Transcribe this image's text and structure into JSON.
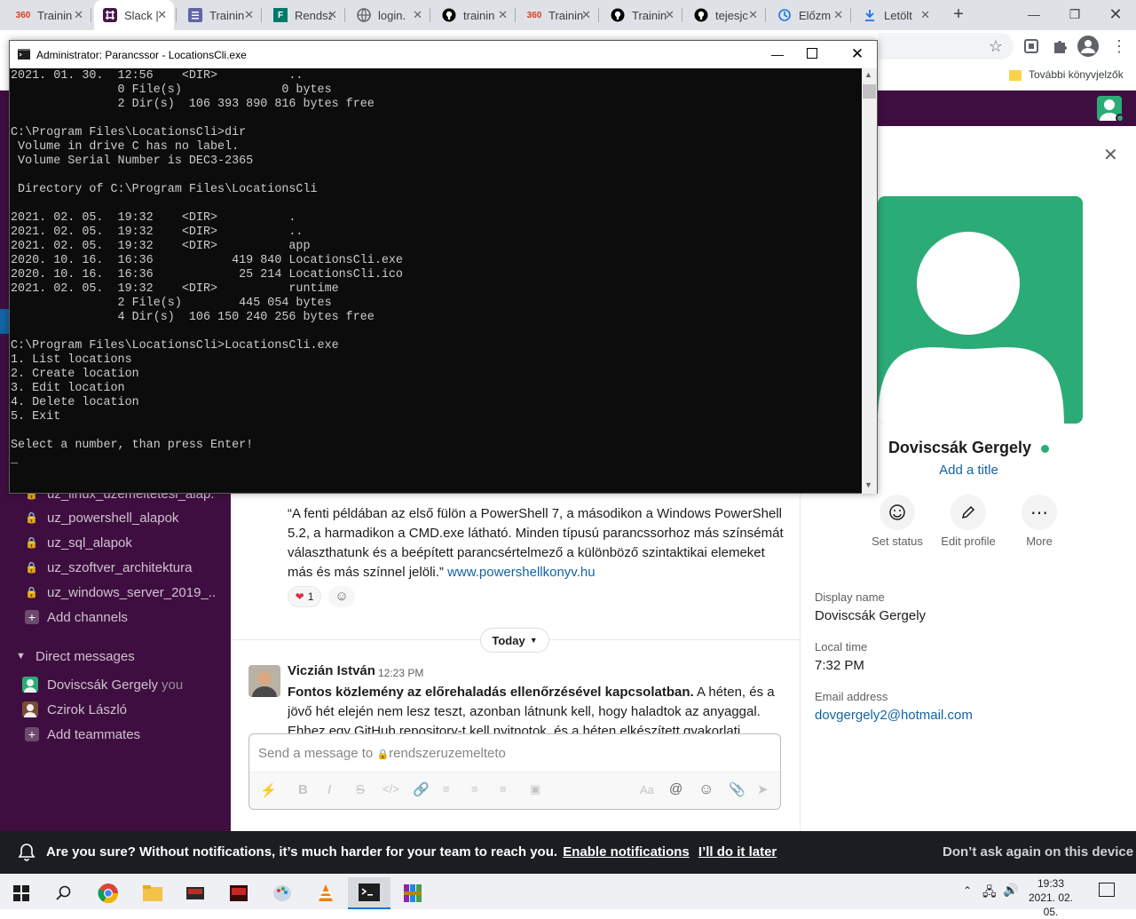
{
  "browser": {
    "tabs": [
      {
        "favicon": "360",
        "title": "Trainin",
        "fav_color": "#e03b25",
        "active": false
      },
      {
        "favicon": "slack-icon",
        "title": "Slack |",
        "fav_color": "#4a154b",
        "active": true
      },
      {
        "favicon": "forms-icon",
        "title": "Trainin",
        "fav_color": "#6264a7",
        "active": false
      },
      {
        "favicon": "F",
        "title": "Rendsz",
        "fav_color": "#00796b",
        "active": false
      },
      {
        "favicon": "globe-icon",
        "title": "login.",
        "fav_color": "#5f6368",
        "active": false
      },
      {
        "favicon": "github-icon",
        "title": "trainin",
        "fav_color": "#000000",
        "active": false
      },
      {
        "favicon": "360",
        "title": "Trainin",
        "fav_color": "#e03b25",
        "active": false
      },
      {
        "favicon": "github-icon",
        "title": "Trainin",
        "fav_color": "#000000",
        "active": false
      },
      {
        "favicon": "github-icon",
        "title": "tejesjc",
        "fav_color": "#000000",
        "active": false
      },
      {
        "favicon": "history-icon",
        "title": "Előzm",
        "fav_color": "#1a73e8",
        "active": false
      },
      {
        "favicon": "download-icon",
        "title": "Letölt",
        "fav_color": "#1a73e8",
        "active": false
      }
    ],
    "bookmarks_other": "További könyvjelzők"
  },
  "cmd": {
    "title": "Administrator: Parancssor - LocationsCli.exe",
    "lines": [
      "2021. 01. 30.  12:56    <DIR>          ..",
      "               0 File(s)              0 bytes",
      "               2 Dir(s)  106 393 890 816 bytes free",
      "",
      "C:\\Program Files\\LocationsCli>dir",
      " Volume in drive C has no label.",
      " Volume Serial Number is DEC3-2365",
      "",
      " Directory of C:\\Program Files\\LocationsCli",
      "",
      "2021. 02. 05.  19:32    <DIR>          .",
      "2021. 02. 05.  19:32    <DIR>          ..",
      "2021. 02. 05.  19:32    <DIR>          app",
      "2020. 10. 16.  16:36           419 840 LocationsCli.exe",
      "2020. 10. 16.  16:36            25 214 LocationsCli.ico",
      "2021. 02. 05.  19:32    <DIR>          runtime",
      "               2 File(s)        445 054 bytes",
      "               4 Dir(s)  106 150 240 256 bytes free",
      "",
      "C:\\Program Files\\LocationsCli>LocationsCli.exe",
      "1. List locations",
      "2. Create location",
      "3. Edit location",
      "4. Delete location",
      "5. Exit",
      "",
      "Select a number, than press Enter!",
      "_"
    ]
  },
  "slack": {
    "channels": [
      {
        "name": "uz_linux_uzemeltetesi_alap..."
      },
      {
        "name": "uz_powershell_alapok"
      },
      {
        "name": "uz_sql_alapok"
      },
      {
        "name": "uz_szoftver_architektura"
      },
      {
        "name": "uz_windows_server_2019_..."
      }
    ],
    "add_channels": "Add channels",
    "dm_header": "Direct messages",
    "dms": [
      {
        "name": "Doviscsák Gergely",
        "suffix": "you"
      },
      {
        "name": "Czirok László",
        "suffix": ""
      }
    ],
    "add_teammates": "Add teammates",
    "quote_text": "“A fenti példában az első fülön a PowerShell 7, a másodikon a Windows PowerShell 5.2, a harmadikon a CMD.exe látható. Minden típusú parancssorhoz más színsémát választhatunk és a beépített parancsértelmező a különböző szintaktikai elemeket más és más színnel jelöli.”",
    "quote_link": "www.powershellkonyv.hu",
    "reaction_count": "1",
    "day_divider": "Today",
    "message": {
      "author": "Viczián István",
      "time": "12:23 PM",
      "bold": "Fontos közlemény az előrehaladás ellenőrzésével kapcsolatban.",
      "text": " A héten, és a jövő hét elején nem lesz teszt, azonban látnunk kell, hogy haladtok az anyaggal. Ehhez egy GitHub repository-t kell nyitnotok, és a héten elkészített gyakorlati feladatokról"
    },
    "composer_placeholder": "Send a message to",
    "composer_channel": "rendszeruzemelteto"
  },
  "profile": {
    "name": "Doviscsák Gergely",
    "add_title": "Add a title",
    "actions": [
      "Set status",
      "Edit profile",
      "More"
    ],
    "display_name_label": "Display name",
    "display_name": "Doviscsák Gergely",
    "local_time_label": "Local time",
    "local_time": "7:32 PM",
    "email_label": "Email address",
    "email": "dovgergely2@hotmail.com",
    "avatar_color": "#2bac76"
  },
  "notification": {
    "text": "Are you sure? Without notifications, it’s much harder for your team to reach you.",
    "enable": "Enable notifications",
    "later": "I’ll do it later",
    "dont_ask": "Don’t ask again on this device"
  },
  "taskbar": {
    "time": "19:33",
    "date": "2021. 02. 05."
  }
}
